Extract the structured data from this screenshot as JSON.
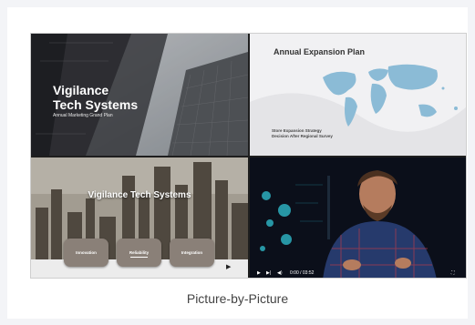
{
  "slides": {
    "cover": {
      "title_line1": "Vigilance",
      "title_line2": "Tech Systems",
      "subtitle": "Annual Marketing Grand Plan"
    },
    "expansion": {
      "title": "Annual Expansion Plan",
      "caption_line1": "Store Expansion Strategy",
      "caption_line2": "Decision After Regional Survey"
    },
    "city": {
      "title": "Vigilance Tech Systems",
      "pills": [
        "Innovation",
        "Reliability",
        "Integration"
      ],
      "selected_index": 1
    }
  },
  "video": {
    "time": "0:00 / 03:52",
    "progress": 0.0
  },
  "caption": "Picture-by-Picture",
  "colors": {
    "page_bg": "#f3f4f7",
    "map_blue": "#8bbbd6",
    "pill": "#8a8078"
  }
}
